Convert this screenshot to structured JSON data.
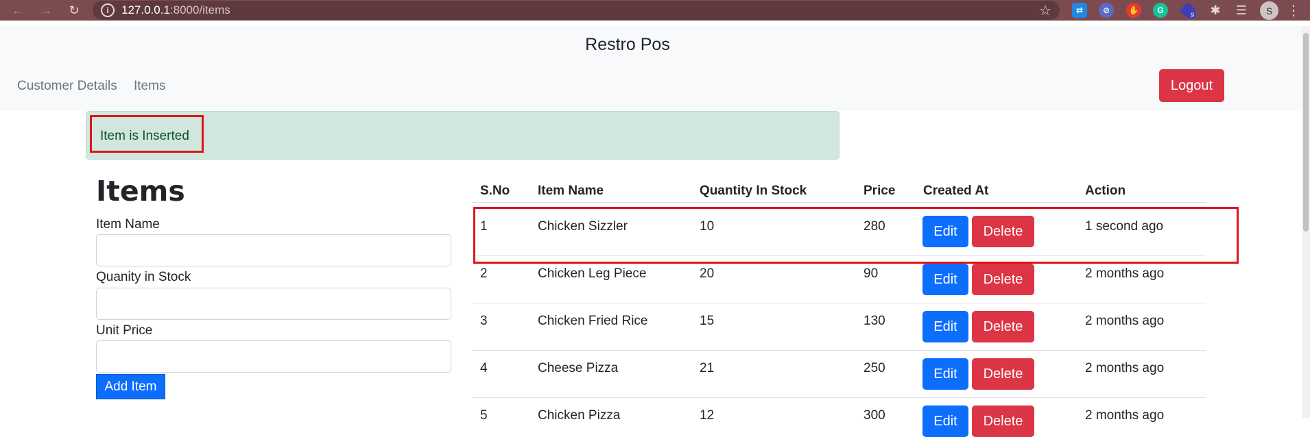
{
  "browser": {
    "url_host": "127.0.0.1",
    "url_rest": ":8000/items",
    "profile_initial": "S",
    "extension_badge": "9"
  },
  "navbar": {
    "brand": "Restro Pos",
    "links": [
      "Customer Details",
      "Items"
    ],
    "logout_label": "Logout"
  },
  "alert": {
    "message": "Item is Inserted"
  },
  "form": {
    "title": "Items",
    "item_name_label": "Item Name",
    "item_name_value": "",
    "quantity_label": "Quanity in Stock",
    "quantity_value": "",
    "price_label": "Unit Price",
    "price_value": "",
    "submit_label": "Add Item"
  },
  "table": {
    "headers": [
      "S.No",
      "Item Name",
      "Quantity In Stock",
      "Price",
      "Created At",
      "Action"
    ],
    "edit_label": "Edit",
    "delete_label": "Delete",
    "rows": [
      {
        "sno": "1",
        "name": "Chicken Sizzler",
        "qty": "10",
        "price": "280",
        "created": "1 second ago"
      },
      {
        "sno": "2",
        "name": "Chicken Leg Piece",
        "qty": "20",
        "price": "90",
        "created": "2 months ago"
      },
      {
        "sno": "3",
        "name": "Chicken Fried Rice",
        "qty": "15",
        "price": "130",
        "created": "2 months ago"
      },
      {
        "sno": "4",
        "name": "Cheese Pizza",
        "qty": "21",
        "price": "250",
        "created": "2 months ago"
      },
      {
        "sno": "5",
        "name": "Chicken Pizza",
        "qty": "12",
        "price": "300",
        "created": "2 months ago"
      }
    ]
  },
  "colors": {
    "primary": "#0d6efd",
    "danger": "#dc3545",
    "success_bg": "#d1e7dd",
    "annotation_red": "#e0131a",
    "browser_chrome": "#7c4b4f"
  }
}
